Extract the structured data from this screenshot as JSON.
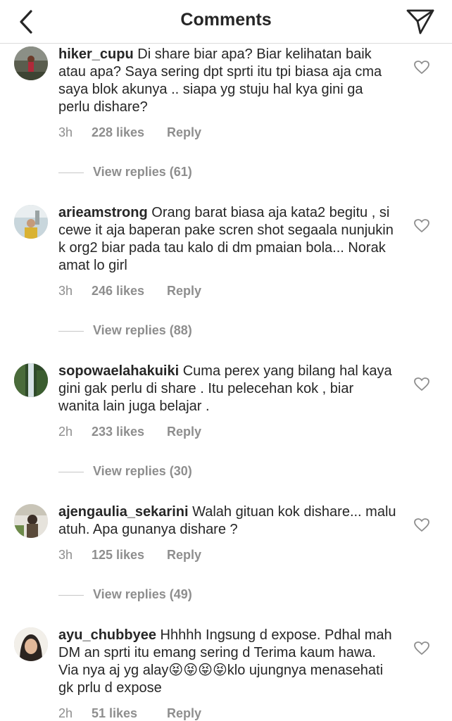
{
  "header": {
    "title": "Comments"
  },
  "comments": [
    {
      "username": "hiker_cupu",
      "text": "Di share biar apa? Biar kelihatan baik atau apa? Saya sering dpt sprti itu tpi biasa aja cma saya blok akunya .. siapa yg stuju hal kya gini ga perlu dishare?",
      "time": "3h",
      "likes": "228 likes",
      "reply": "Reply",
      "view_replies": "View replies (61)"
    },
    {
      "username": "arieamstrong",
      "text": "Orang barat biasa aja kata2 begitu , si cewe it aja baperan pake scren shot segaala nunjukin k org2 biar pada tau kalo di dm pmaian bola... Norak amat lo girl",
      "time": "3h",
      "likes": "246 likes",
      "reply": "Reply",
      "view_replies": "View replies (88)"
    },
    {
      "username": "sopowaelahakuiki",
      "text": "Cuma perex yang bilang hal kaya gini gak perlu di share . Itu pelecehan kok , biar wanita lain juga belajar .",
      "time": "2h",
      "likes": "233 likes",
      "reply": "Reply",
      "view_replies": "View replies (30)"
    },
    {
      "username": "ajengaulia_sekarini",
      "text": "Walah gituan kok dishare... malu atuh. Apa gunanya dishare ?",
      "time": "3h",
      "likes": "125 likes",
      "reply": "Reply",
      "view_replies": "View replies (49)"
    },
    {
      "username": "ayu_chubbyee",
      "text": "Hhhhh Ingsung d expose. Pdhal mah DM an sprti itu emang sering d Terima kaum hawa. Via nya aj yg alay😝😝😝😝klo ujungnya menasehati gk prlu d expose",
      "time": "2h",
      "likes": "51 likes",
      "reply": "Reply"
    }
  ]
}
